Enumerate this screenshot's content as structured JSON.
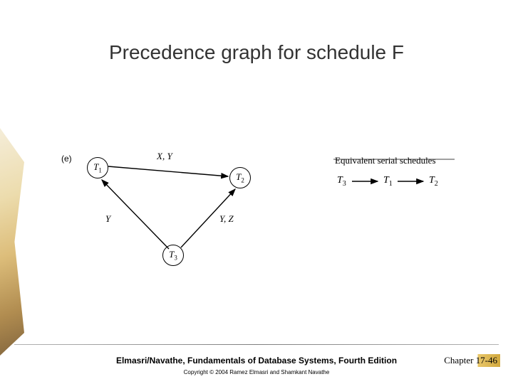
{
  "title": "Precedence graph for schedule F",
  "label_e": "(e)",
  "nodes": {
    "t1": "T",
    "t1sub": "1",
    "t2": "T",
    "t2sub": "2",
    "t3": "T",
    "t3sub": "3"
  },
  "edges": {
    "xy": "X, Y",
    "y": "Y",
    "yz": "Y, Z"
  },
  "serial_header": "Equivalent serial schedules",
  "serial_seq": {
    "t3": "T",
    "t3sub": "3",
    "t1": "T",
    "t1sub": "1",
    "t2": "T",
    "t2sub": "2"
  },
  "footer_text": "Elmasri/Navathe, Fundamentals of Database Systems, Fourth Edition",
  "copyright_text": "Copyright © 2004 Ramez Elmasri and Shamkant Navathe",
  "chapter_text": "Chapter 17-46",
  "chart_data": {
    "type": "directed_graph",
    "title": "Precedence graph for schedule F",
    "nodes": [
      "T1",
      "T2",
      "T3"
    ],
    "edges": [
      {
        "from": "T1",
        "to": "T2",
        "label": "X, Y"
      },
      {
        "from": "T3",
        "to": "T1",
        "label": "Y"
      },
      {
        "from": "T3",
        "to": "T2",
        "label": "Y, Z"
      }
    ],
    "equivalent_serial_schedules": [
      [
        "T3",
        "T1",
        "T2"
      ]
    ]
  }
}
